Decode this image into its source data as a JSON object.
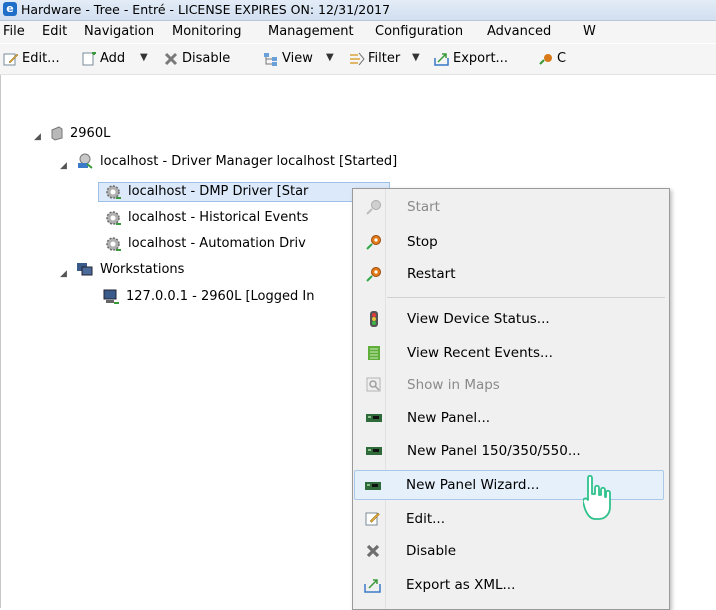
{
  "window": {
    "title": "Hardware - Tree - Entré - LICENSE EXPIRES ON: 12/31/2017",
    "app_icon_glyph": "e"
  },
  "menu": [
    "File",
    "Edit",
    "Navigation",
    "Monitoring",
    "Management",
    "Configuration",
    "Advanced",
    "W"
  ],
  "toolbar": {
    "edit": "Edit...",
    "add": "Add",
    "disable": "Disable",
    "view": "View",
    "filter": "Filter",
    "export": "Export...",
    "cut": "C"
  },
  "tree": {
    "root": "2960L",
    "driver_manager": "localhost - Driver Manager localhost [Started]",
    "dmp_driver": "localhost - DMP Driver [Star",
    "historical": "localhost - Historical Events",
    "automation": "localhost - Automation Driv",
    "workstations": "Workstations",
    "workstation_item": "127.0.0.1 - 2960L [Logged In"
  },
  "context_menu": {
    "start": "Start",
    "stop": "Stop",
    "restart": "Restart",
    "view_device_status": "View Device Status...",
    "view_recent_events": "View Recent Events...",
    "show_in_maps": "Show in Maps",
    "new_panel": "New Panel...",
    "new_panel_150": "New Panel 150/350/550...",
    "new_panel_wizard": "New Panel Wizard...",
    "edit": "Edit...",
    "disable": "Disable",
    "export_xml": "Export as XML..."
  },
  "colors": {
    "accent": "#1f6fc8",
    "selection": "#dbe9fa",
    "hover": "#e6f0fb",
    "cursor": "#2fc28d"
  }
}
